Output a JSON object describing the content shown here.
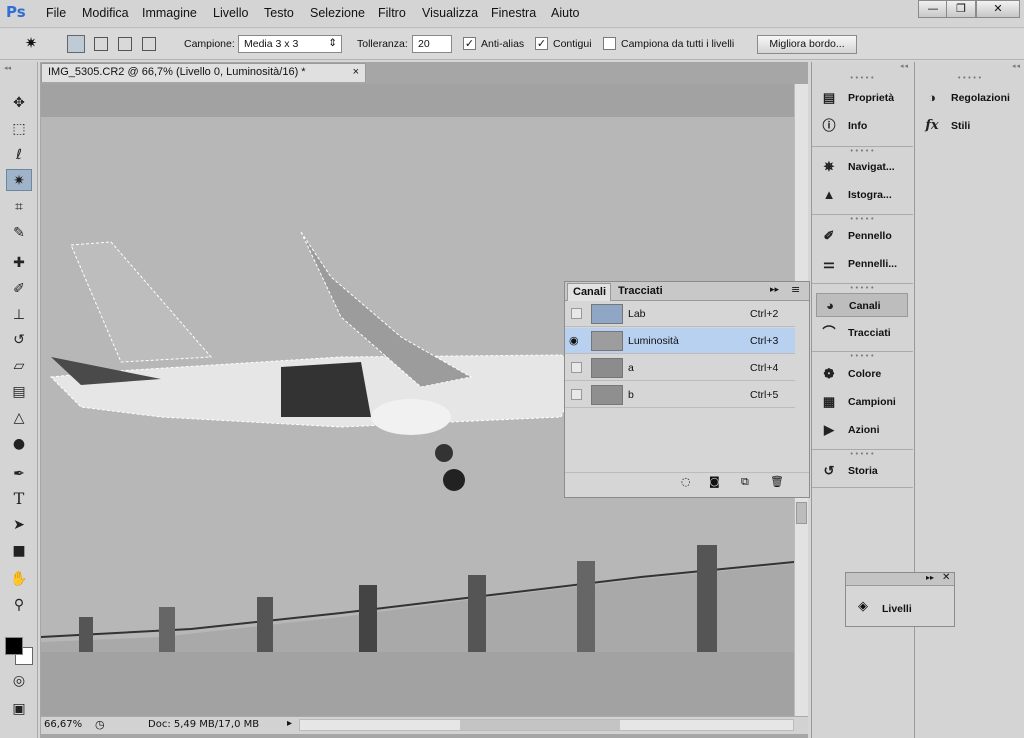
{
  "app": {
    "logo": "Ps"
  },
  "menu": [
    "File",
    "Modifica",
    "Immagine",
    "Livello",
    "Testo",
    "Selezione",
    "Filtro",
    "Visualizza",
    "Finestra",
    "Aiuto"
  ],
  "window_controls": {
    "minimize": "—",
    "restore": "❐",
    "close": "✕"
  },
  "options": {
    "sample_label": "Campione:",
    "sample_value": "Media 3 x 3",
    "tolerance_label": "Tolleranza:",
    "tolerance_value": "20",
    "antialias_label": "Anti-alias",
    "contiguous_label": "Contigui",
    "all_layers_label": "Campiona da tutti i livelli",
    "refine_button": "Migliora bordo...",
    "antialias_checked": true,
    "contiguous_checked": true,
    "all_layers_checked": false
  },
  "document": {
    "tab_title": "IMG_5305.CR2 @ 66,7% (Livello 0, Luminosità/16) *"
  },
  "status": {
    "zoom": "66,67%",
    "doc_info": "Doc: 5,49 MB/17,0 MB"
  },
  "channels_panel": {
    "tabs": [
      "Canali",
      "Tracciati"
    ],
    "channels": [
      {
        "name": "Lab",
        "shortcut": "Ctrl+2",
        "visible": false,
        "selected": false
      },
      {
        "name": "Luminosità",
        "shortcut": "Ctrl+3",
        "visible": true,
        "selected": true
      },
      {
        "name": "a",
        "shortcut": "Ctrl+4",
        "visible": false,
        "selected": false
      },
      {
        "name": "b",
        "shortcut": "Ctrl+5",
        "visible": false,
        "selected": false
      }
    ]
  },
  "dock1": [
    {
      "label": "Proprietà",
      "icon": "properties-icon"
    },
    {
      "label": "Info",
      "icon": "info-icon"
    },
    {
      "label": "Navigat...",
      "icon": "navigator-icon"
    },
    {
      "label": "Istogra...",
      "icon": "histogram-icon"
    },
    {
      "label": "Pennello",
      "icon": "brush-icon"
    },
    {
      "label": "Pennelli...",
      "icon": "brush-presets-icon"
    },
    {
      "label": "Canali",
      "icon": "channels-icon"
    },
    {
      "label": "Tracciati",
      "icon": "paths-icon"
    },
    {
      "label": "Colore",
      "icon": "color-icon"
    },
    {
      "label": "Campioni",
      "icon": "swatches-icon"
    },
    {
      "label": "Azioni",
      "icon": "actions-icon"
    },
    {
      "label": "Storia",
      "icon": "history-icon"
    }
  ],
  "dock2": [
    {
      "label": "Regolazioni",
      "icon": "adjustments-icon"
    },
    {
      "label": "Stili",
      "icon": "styles-icon"
    }
  ],
  "layers_float": {
    "label": "Livelli"
  },
  "colors": {
    "accent": "#2f6fd6",
    "selected_row": "#b9d1f0",
    "active_tool": "#9fb4c9"
  }
}
